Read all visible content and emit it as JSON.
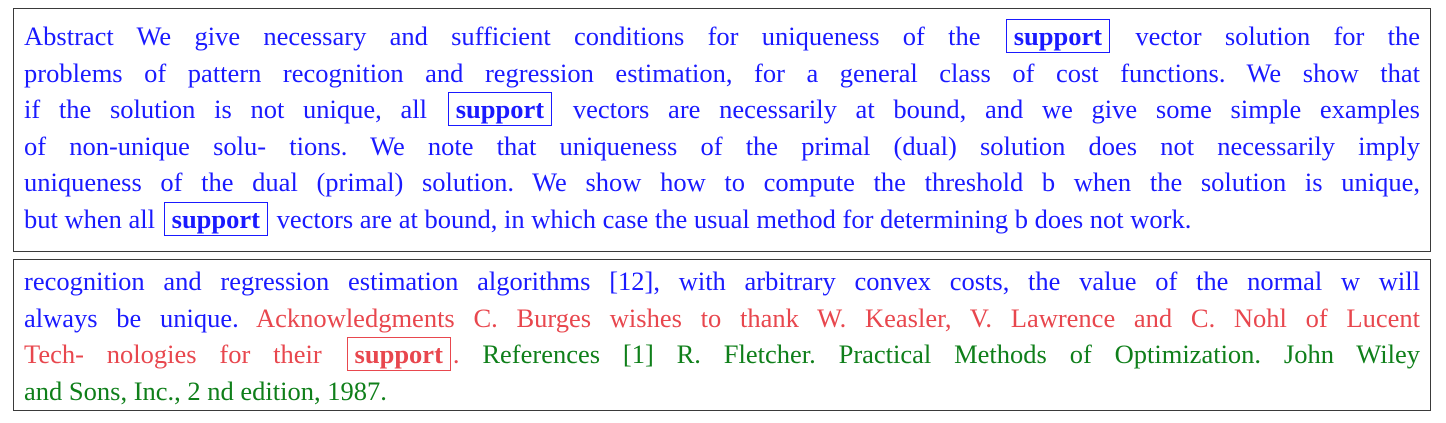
{
  "panel1": {
    "lines": [
      [
        {
          "t": "Abstract We give necessary and sufficient conditions for uniqueness of the ",
          "c": "blue"
        },
        {
          "t": "support",
          "c": "blue",
          "kw": true
        },
        {
          "t": " vector solution for the",
          "c": "blue"
        }
      ],
      [
        {
          "t": "problems of pattern recognition and regression estimation, for a general class of cost functions. We show that",
          "c": "blue"
        }
      ],
      [
        {
          "t": "if the solution is not unique, all ",
          "c": "blue"
        },
        {
          "t": "support",
          "c": "blue",
          "kw": true
        },
        {
          "t": " vectors are necessarily at bound, and we give some simple examples",
          "c": "blue"
        }
      ],
      [
        {
          "t": "of non-unique solu- tions.  We note that uniqueness of the primal (dual) solution does not necessarily imply",
          "c": "blue"
        }
      ],
      [
        {
          "t": "uniqueness of the dual (primal) solution. We show how to compute the threshold b when the solution is unique,",
          "c": "blue"
        }
      ],
      [
        {
          "t": "but when all ",
          "c": "blue"
        },
        {
          "t": "support",
          "c": "blue",
          "kw": true
        },
        {
          "t": " vectors are at bound, in which case the usual method for determining b does not work.",
          "c": "blue"
        }
      ]
    ]
  },
  "panel2": {
    "lines": [
      [
        {
          "t": "recognition and regression estimation algorithms [12], with arbitrary convex costs, the value of the normal w will",
          "c": "blue"
        }
      ],
      [
        {
          "t": "always be unique. ",
          "c": "blue"
        },
        {
          "t": "Acknowledgments C. Burges wishes to thank W. Keasler, V. Lawrence and C. Nohl of Lucent",
          "c": "red"
        }
      ],
      [
        {
          "t": "Tech- nologies for their ",
          "c": "red"
        },
        {
          "t": "support",
          "c": "red",
          "kw": true
        },
        {
          "t": ".",
          "c": "red"
        },
        {
          "t": "   References [1] R. Fletcher. Practical Methods of Optimization. John Wiley",
          "c": "green"
        }
      ],
      [
        {
          "t": "and Sons, Inc., 2 nd edition, 1987.",
          "c": "green"
        }
      ]
    ]
  }
}
